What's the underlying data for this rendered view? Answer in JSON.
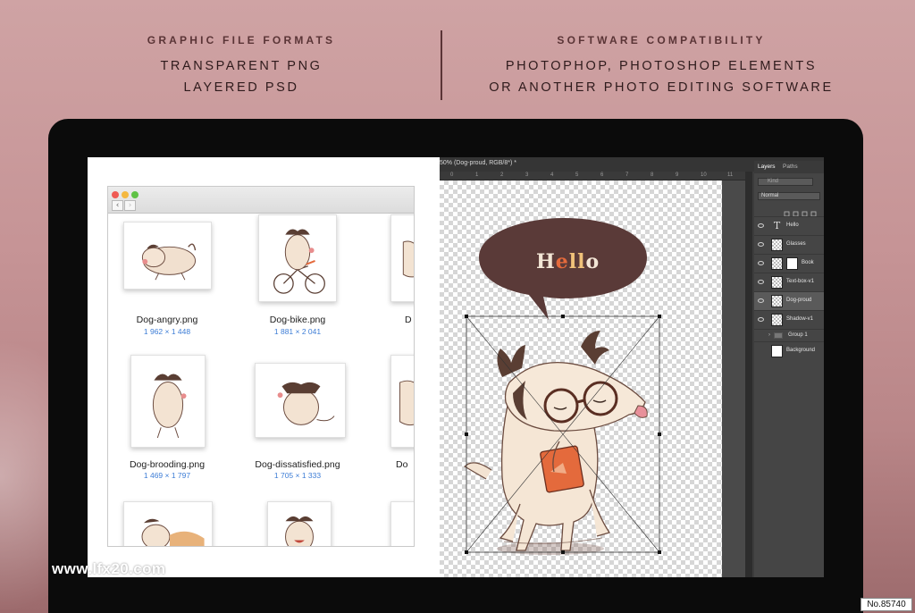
{
  "header": {
    "left": {
      "title": "GRAPHIC FILE FORMATS",
      "lines": [
        "TRANSPARENT PNG",
        "LAYERED PSD"
      ]
    },
    "right": {
      "title": "SOFTWARE COMPATIBILITY",
      "lines": [
        "PHOTOPHOP, PHOTOSHOP ELEMENTS",
        "OR ANOTHER PHOTO EDITING SOFTWARE"
      ]
    }
  },
  "finder": {
    "files": [
      {
        "name": "Dog-angry.png",
        "size": "1 962 × 1 448"
      },
      {
        "name": "Dog-bike.png",
        "size": "1 881 × 2 041"
      },
      {
        "name": "D",
        "size": ""
      },
      {
        "name": "Dog-brooding.png",
        "size": "1 469 × 1 797"
      },
      {
        "name": "Dog-dissatisfied.png",
        "size": "1 705 × 1 333"
      },
      {
        "name": "Do",
        "size": ""
      }
    ]
  },
  "photoshop": {
    "doc_tab": "50% (Dog-proud, RGB/8*) *",
    "ruler_numbers": [
      "0",
      "1",
      "2",
      "3",
      "4",
      "5",
      "6",
      "7",
      "8",
      "9",
      "10",
      "11"
    ],
    "speech_text": {
      "h": "H",
      "e": "e",
      "ll": "ll",
      "o": "o"
    },
    "layers_panel": {
      "tabs": [
        "Layers",
        "Paths"
      ],
      "search_placeholder": "Kind",
      "blend_mode": "Normal",
      "layers": [
        {
          "name": "Hello",
          "kind": "text",
          "selected": false
        },
        {
          "name": "Glasses",
          "kind": "image",
          "selected": false
        },
        {
          "name": "Book",
          "kind": "mask",
          "selected": false
        },
        {
          "name": "Text-box-v1",
          "kind": "image",
          "selected": false
        },
        {
          "name": "Dog-proud",
          "kind": "image",
          "selected": true
        },
        {
          "name": "Shadow-v1",
          "kind": "image",
          "selected": false
        },
        {
          "name": "Group 1",
          "kind": "group",
          "selected": false
        },
        {
          "name": "Background",
          "kind": "fill",
          "selected": false
        }
      ]
    }
  },
  "watermark": "www.lfx20.com",
  "stock_number": "No.85740",
  "colors": {
    "background": "#c69496",
    "header_text": "#3d2526",
    "speech_bubble": "#5a3a38",
    "speech_letter_e": "#e46a3c",
    "speech_letter_ll": "#f0c27a",
    "file_size_blue": "#3d7dd6",
    "ps_dark": "#3c3c3c"
  }
}
